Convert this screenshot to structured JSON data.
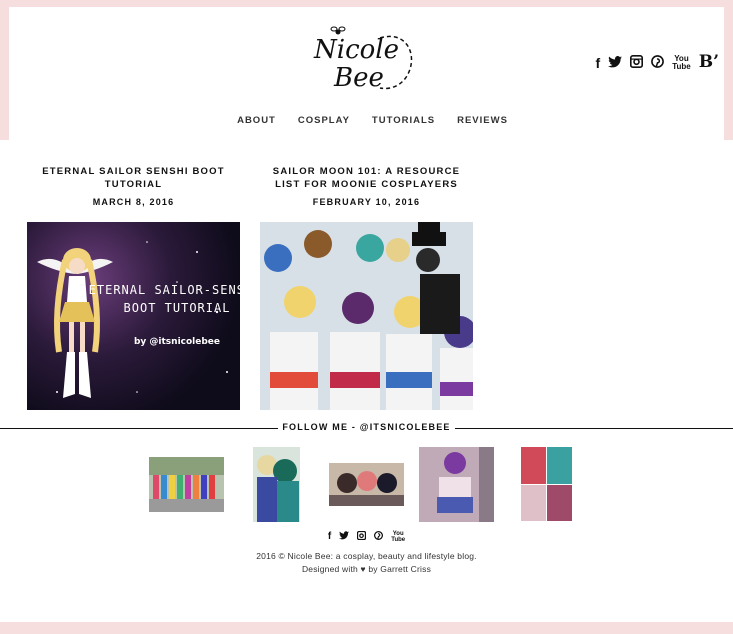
{
  "site": {
    "logo_text_1": "Nicole",
    "logo_text_2": "Bee"
  },
  "social_icons": [
    "facebook-icon",
    "twitter-icon",
    "instagram-icon",
    "pinterest-icon",
    "youtube-icon",
    "bloglovin-icon"
  ],
  "social_glyphs": {
    "facebook": "f",
    "twitter": "🐦",
    "instagram": "◙",
    "pinterest": "℗",
    "youtube_1": "You",
    "youtube_2": "Tube",
    "bloglovin": "B’"
  },
  "nav": {
    "items": [
      "ABOUT",
      "COSPLAY",
      "TUTORIALS",
      "REVIEWS"
    ]
  },
  "posts": [
    {
      "title": "ETERNAL SAILOR SENSHI BOOT TUTORIAL",
      "date": "MARCH 8, 2016",
      "image_text_1": "ETERNAL SAILOR-SENSHI",
      "image_text_2": "BOOT TUTORIAL",
      "image_text_3": "by @itsnicolebee"
    },
    {
      "title": "SAILOR MOON 101: A RESOURCE LIST FOR MOONIE COSPLAYERS",
      "date": "FEBRUARY 10, 2016"
    }
  ],
  "follow": {
    "label": "FOLLOW ME - @ITSNICOLEBEE"
  },
  "footer": {
    "line1": "2016 © Nicole Bee: a cosplay, beauty and lifestyle blog.",
    "line2": "Designed with ♥ by Garrett Criss"
  }
}
